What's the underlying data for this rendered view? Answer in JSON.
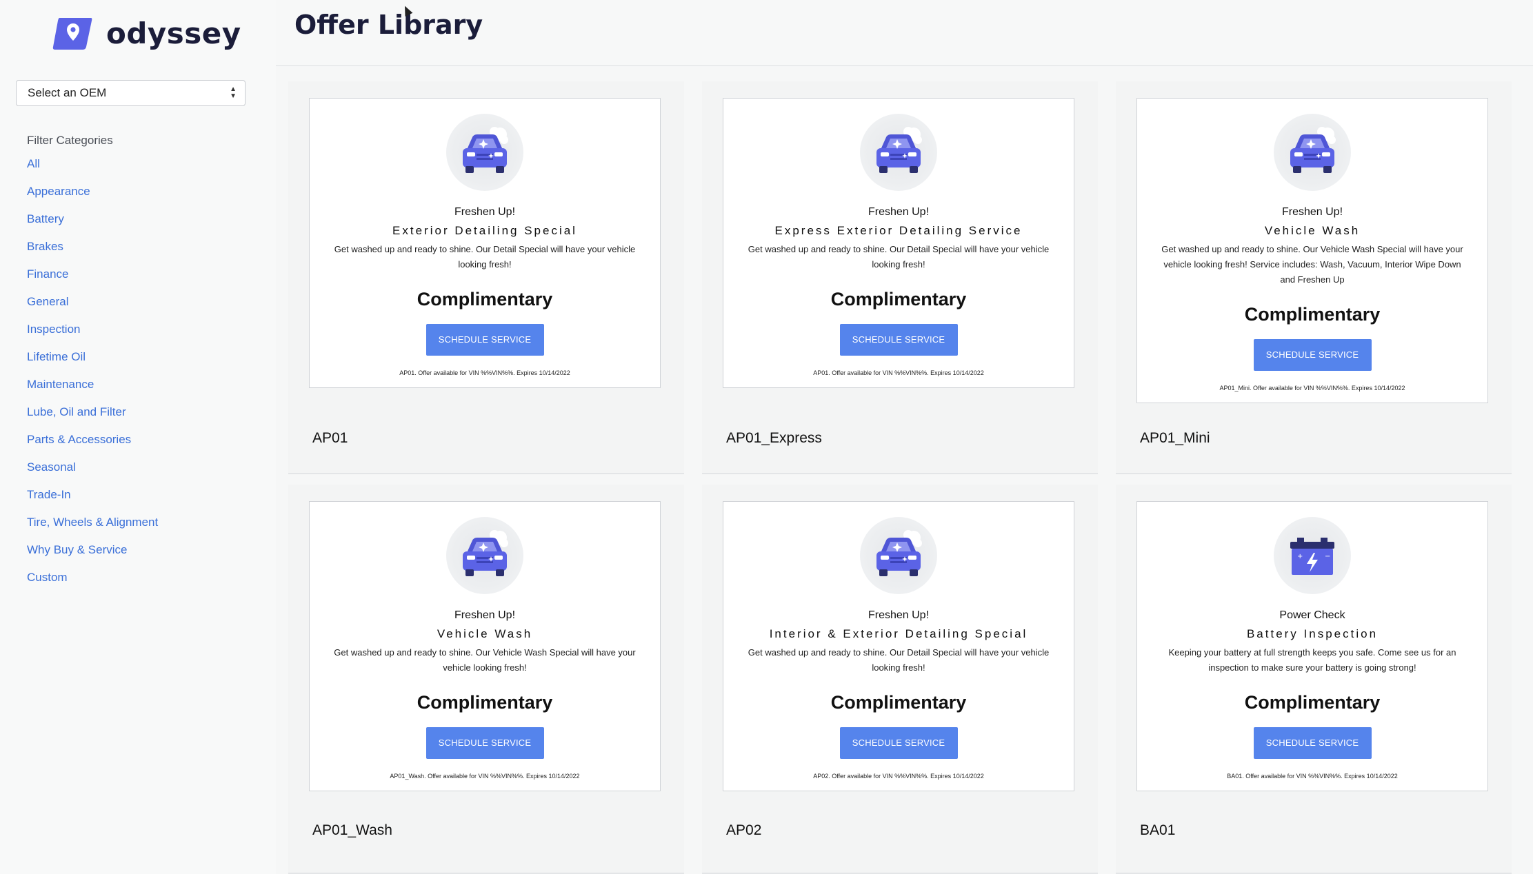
{
  "app": {
    "name": "odyssey"
  },
  "page": {
    "title": "Offer Library"
  },
  "sidebar": {
    "oem_select": {
      "value": "Select an OEM"
    },
    "filter_title": "Filter Categories",
    "filters": [
      "All",
      "Appearance",
      "Battery",
      "Brakes",
      "Finance",
      "General",
      "Inspection",
      "Lifetime Oil",
      "Maintenance",
      "Lube, Oil and Filter",
      "Parts & Accessories",
      "Seasonal",
      "Trade-In",
      "Tire, Wheels & Alignment",
      "Why Buy & Service",
      "Custom"
    ]
  },
  "offers": [
    {
      "code": "AP01",
      "icon": "car-wash-icon",
      "headline": "Freshen Up!",
      "subhead": "Exterior Detailing Special",
      "description": "Get washed up and ready to shine. Our Detail Special will have your vehicle looking fresh!",
      "price": "Complimentary",
      "button": "SCHEDULE SERVICE",
      "fine_print": "AP01. Offer available for VIN %%VIN%%. Expires 10/14/2022"
    },
    {
      "code": "AP01_Express",
      "icon": "car-wash-icon",
      "headline": "Freshen Up!",
      "subhead": "Express Exterior Detailing Service",
      "description": "Get washed up and ready to shine. Our Detail Special will have your vehicle looking fresh!",
      "price": "Complimentary",
      "button": "SCHEDULE SERVICE",
      "fine_print": "AP01. Offer available for VIN %%VIN%%. Expires 10/14/2022"
    },
    {
      "code": "AP01_Mini",
      "icon": "car-wash-icon",
      "headline": "Freshen Up!",
      "subhead": "Vehicle Wash",
      "description": "Get washed up and ready to shine. Our Vehicle Wash Special will have your vehicle looking fresh! Service includes: Wash, Vacuum, Interior Wipe Down and Freshen Up",
      "price": "Complimentary",
      "button": "SCHEDULE SERVICE",
      "fine_print": "AP01_Mini. Offer available for VIN %%VIN%%. Expires 10/14/2022"
    },
    {
      "code": "AP01_Wash",
      "icon": "car-wash-icon",
      "headline": "Freshen Up!",
      "subhead": "Vehicle Wash",
      "description": "Get washed up and ready to shine. Our Vehicle Wash Special will have your vehicle looking fresh!",
      "price": "Complimentary",
      "button": "SCHEDULE SERVICE",
      "fine_print": "AP01_Wash. Offer available for VIN %%VIN%%. Expires 10/14/2022"
    },
    {
      "code": "AP02",
      "icon": "car-wash-icon",
      "headline": "Freshen Up!",
      "subhead": "Interior & Exterior Detailing Special",
      "description": "Get washed up and ready to shine. Our Detail Special will have your vehicle looking fresh!",
      "price": "Complimentary",
      "button": "SCHEDULE SERVICE",
      "fine_print": "AP02. Offer available for VIN %%VIN%%. Expires 10/14/2022"
    },
    {
      "code": "BA01",
      "icon": "battery-icon",
      "headline": "Power Check",
      "subhead": "Battery Inspection",
      "description": "Keeping your battery at full strength keeps you safe. Come see us for an inspection to make sure your battery is going strong!",
      "price": "Complimentary",
      "button": "SCHEDULE SERVICE",
      "fine_print": "BA01. Offer available for VIN %%VIN%%. Expires 10/14/2022"
    }
  ],
  "colors": {
    "brand": "#5b63e6",
    "link": "#3a6fd8",
    "button": "#5584ec"
  }
}
